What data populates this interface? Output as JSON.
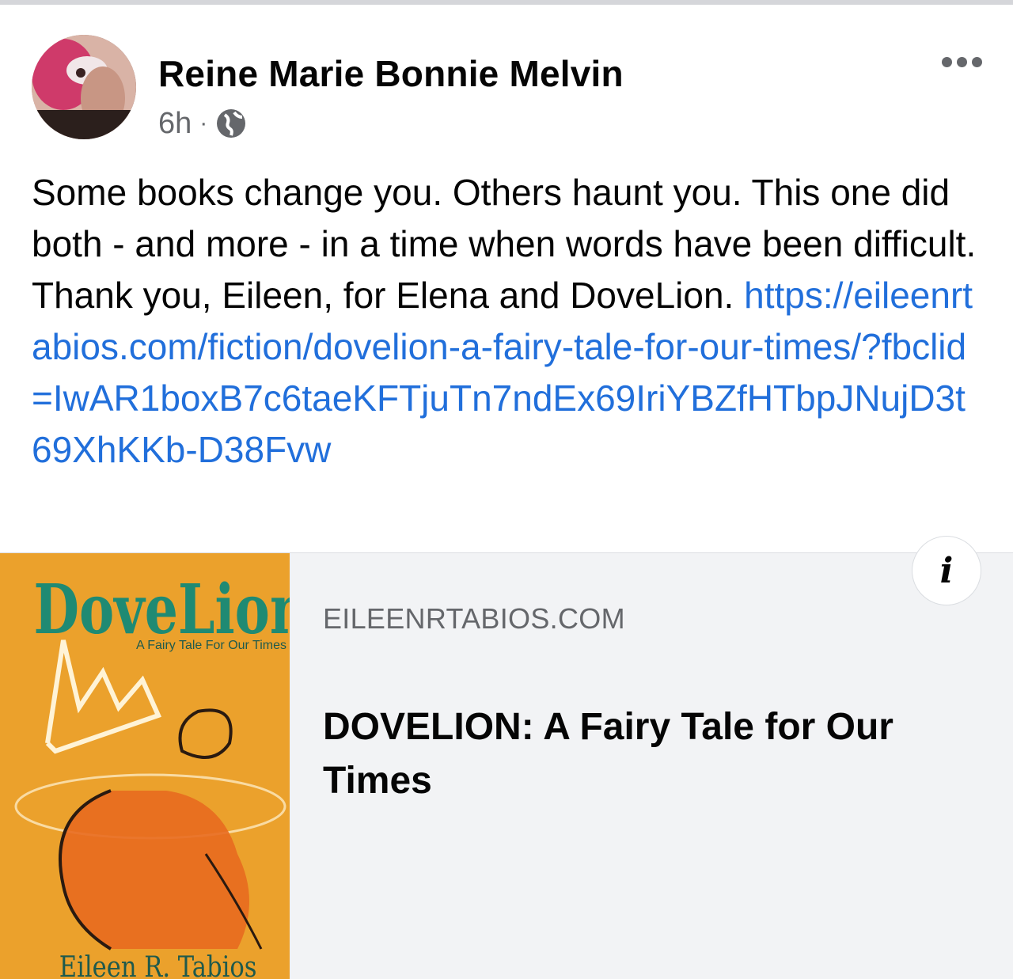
{
  "post": {
    "author": "Reine Marie Bonnie Melvin",
    "time": "6h",
    "separator": "·",
    "audience_icon": "globe-icon",
    "more_icon": "more-options-icon",
    "text": "Some books change you. Others haunt you. This one did both - and more - in a time when words have been difficult. Thank you, Eileen, for Elena and DoveLion. ",
    "link": "https://eileenrtabios.com/fiction/dovelion-a-fairy-tale-for-our-times/?fbclid=IwAR1boxB7c6taeKFTjuTn7ndEx69IriYBZfHTbpJNujD3t69XhKKb-D38Fvw"
  },
  "card": {
    "domain": "EILEENRTABIOS.COM",
    "title": "DOVELION: A Fairy Tale for Our Times",
    "info_label": "i",
    "thumbnail": {
      "book_title": "DoveLion",
      "book_subtitle": "A Fairy Tale For Our Times",
      "book_author": "Eileen R. Tabios",
      "cover_color": "#eba12c",
      "title_color": "#1f8a73"
    }
  },
  "colors": {
    "link": "#216fdb",
    "secondary_text": "#65676b",
    "primary_text": "#050505"
  }
}
